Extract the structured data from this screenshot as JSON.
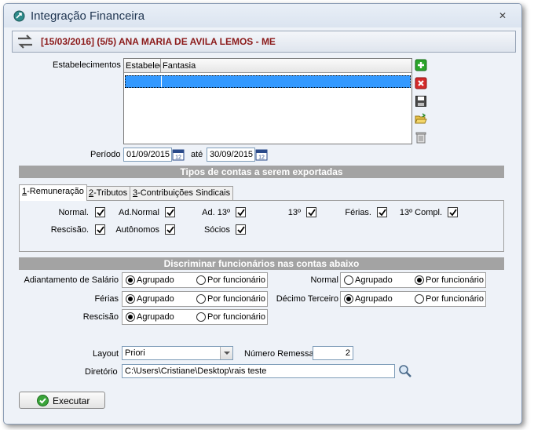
{
  "window": {
    "title": "Integração Financeira",
    "close_symbol": "✕"
  },
  "header": {
    "text": "[15/03/2016] (5/5) ANA MARIA DE AVILA LEMOS - ME"
  },
  "estabelecimentos": {
    "label": "Estabelecimentos",
    "columns": [
      "Estabelec",
      "Fantasia"
    ],
    "actions": [
      "add-icon",
      "delete-icon",
      "save-icon",
      "open-folder-icon",
      "trash-icon"
    ]
  },
  "periodo": {
    "label": "Período",
    "start": "01/09/2015",
    "until_label": "até",
    "end": "30/09/2015",
    "calendar_icon_text": "12"
  },
  "tipos": {
    "title": "Tipos de contas a serem exportadas",
    "tabs": [
      {
        "key": "1",
        "rest": "-Remuneração",
        "active": true
      },
      {
        "key": "2",
        "rest": "-Tributos",
        "active": false
      },
      {
        "key": "3",
        "rest": "-Contribuições Sindicais",
        "active": false
      }
    ],
    "checks": [
      {
        "label": "Normal.",
        "checked": true
      },
      {
        "label": "Ad.Normal",
        "checked": true
      },
      {
        "label": "Ad. 13º",
        "checked": true
      },
      {
        "label": "13º",
        "checked": true
      },
      {
        "label": "Férias.",
        "checked": true
      },
      {
        "label": "13º Compl.",
        "checked": true
      },
      {
        "label": "Rescisão.",
        "checked": true
      },
      {
        "label": "Autônomos",
        "checked": true
      },
      {
        "label": "Sócios",
        "checked": true
      }
    ]
  },
  "discriminar": {
    "title": "Discriminar funcionários nas contas abaixo",
    "option_a": "Agrupado",
    "option_b": "Por funcionário",
    "groups": [
      {
        "label": "Adiantamento de Salário",
        "selected": "Agrupado"
      },
      {
        "label": "Férias",
        "selected": "Agrupado"
      },
      {
        "label": "Rescisão",
        "selected": "Agrupado"
      },
      {
        "label": "Normal",
        "selected": "Por funcionário"
      },
      {
        "label": "Décimo Terceiro",
        "selected": "Agrupado"
      }
    ]
  },
  "layout": {
    "label": "Layout",
    "value": "Priori"
  },
  "remessa": {
    "label": "Número Remessa",
    "value": "2"
  },
  "diretorio": {
    "label": "Diretório",
    "value": "C:\\Users\\Cristiane\\Desktop\\rais teste"
  },
  "execute": {
    "label": "Executar"
  },
  "colors": {
    "accent_red": "#8b1a1a",
    "section_gray": "#a3a3a3",
    "selection_blue": "#3399ff",
    "window_bg": "#eef2f8"
  }
}
